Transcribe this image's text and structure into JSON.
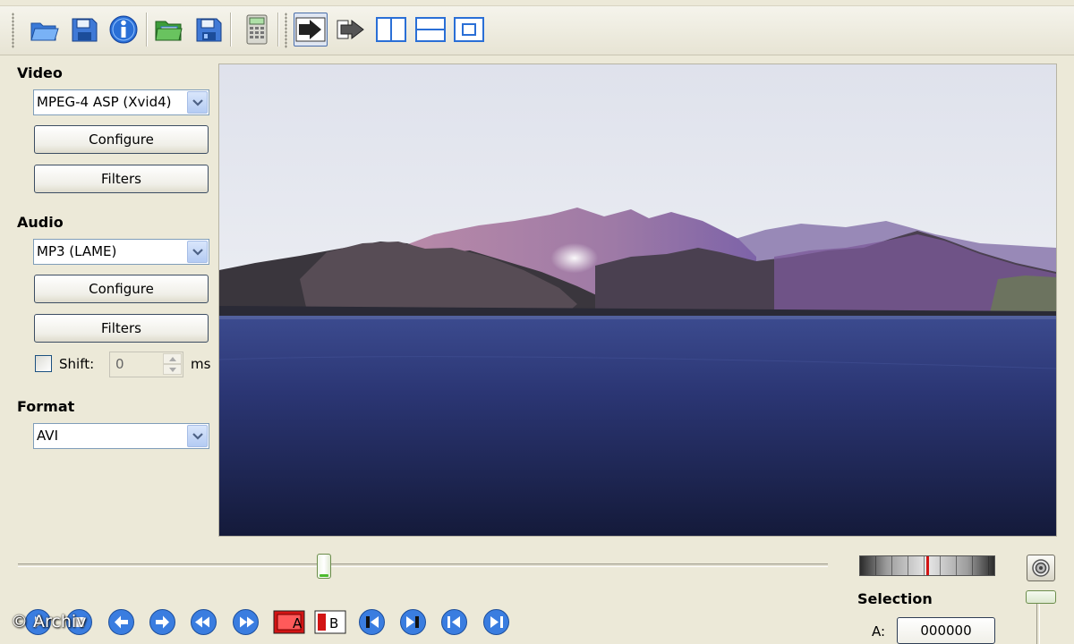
{
  "toolbar": {
    "icons": [
      "open-folder-icon",
      "save-floppy-icon",
      "info-icon",
      "open-green-folder-icon",
      "save-video-floppy-icon",
      "calculator-icon",
      "output-mode-play-icon",
      "output-mode-arrow-icon",
      "split-vertical-icon",
      "split-horizontal-icon",
      "single-pane-icon"
    ]
  },
  "video": {
    "label": "Video",
    "codec": "MPEG-4 ASP (Xvid4)",
    "configure_label": "Configure",
    "filters_label": "Filters"
  },
  "audio": {
    "label": "Audio",
    "codec": "MP3 (LAME)",
    "configure_label": "Configure",
    "filters_label": "Filters",
    "shift_label": "Shift:",
    "shift_value": "0",
    "shift_unit": "ms",
    "shift_checked": false
  },
  "format": {
    "label": "Format",
    "container": "AVI"
  },
  "timeline": {
    "seek_fraction": 0.378,
    "jog_fraction": 0.49
  },
  "selection": {
    "label": "Selection",
    "a_label": "A:",
    "a_value": "000000"
  },
  "navigation": {
    "icons": [
      "play-icon",
      "stop-icon",
      "previous-frame-icon",
      "next-frame-icon",
      "rewind-icon",
      "fast-forward-icon",
      "set-marker-a-icon",
      "set-marker-b-icon",
      "go-to-start-icon",
      "go-to-end-icon",
      "previous-keyframe-icon",
      "next-keyframe-icon"
    ]
  },
  "watermark": "© Archiv",
  "colors": {
    "window_bg": "#ece9d8",
    "accent_blue": "#2a6fd6",
    "marker_red": "#d21414",
    "slider_green": "#4dbb2e"
  }
}
